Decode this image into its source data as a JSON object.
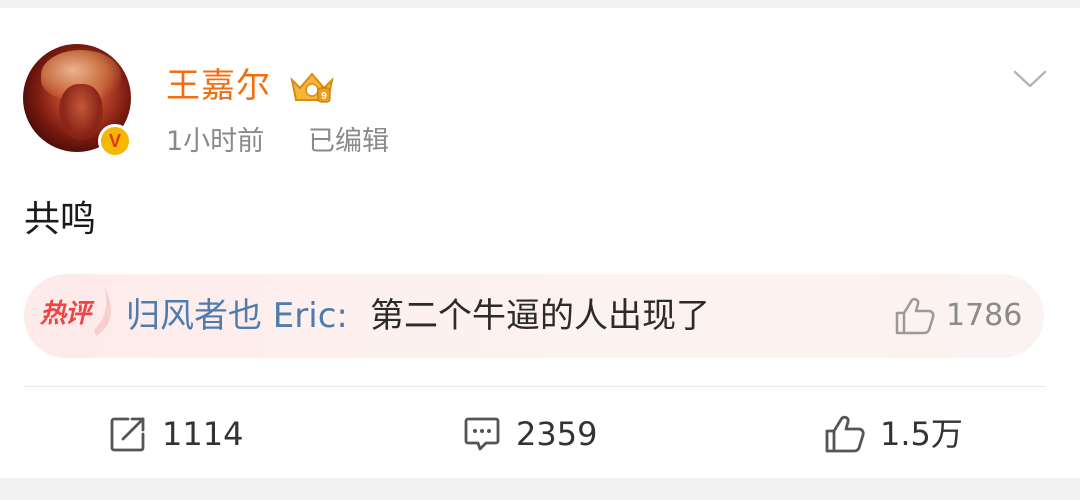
{
  "post": {
    "author": "王嘉尔",
    "time": "1小时前",
    "edited": "已编辑",
    "text": "共鸣",
    "verified_mark": "V"
  },
  "hot_comment": {
    "badge": "热评",
    "user": "归风者也 Eric:",
    "text": "第二个牛逼的人出现了",
    "likes": "1786"
  },
  "actions": {
    "repost_count": "1114",
    "comment_count": "2359",
    "like_count": "1.5万"
  },
  "icons": {
    "menu": "chevron-down-icon",
    "member": "crown-icon",
    "repost": "repost-icon",
    "comment": "comment-icon",
    "like": "thumbs-up-icon"
  },
  "colors": {
    "author_name": "#f36e10",
    "comment_user": "#4f7cad",
    "hot_label": "#ee4444",
    "verified_badge": "#f5b800"
  }
}
